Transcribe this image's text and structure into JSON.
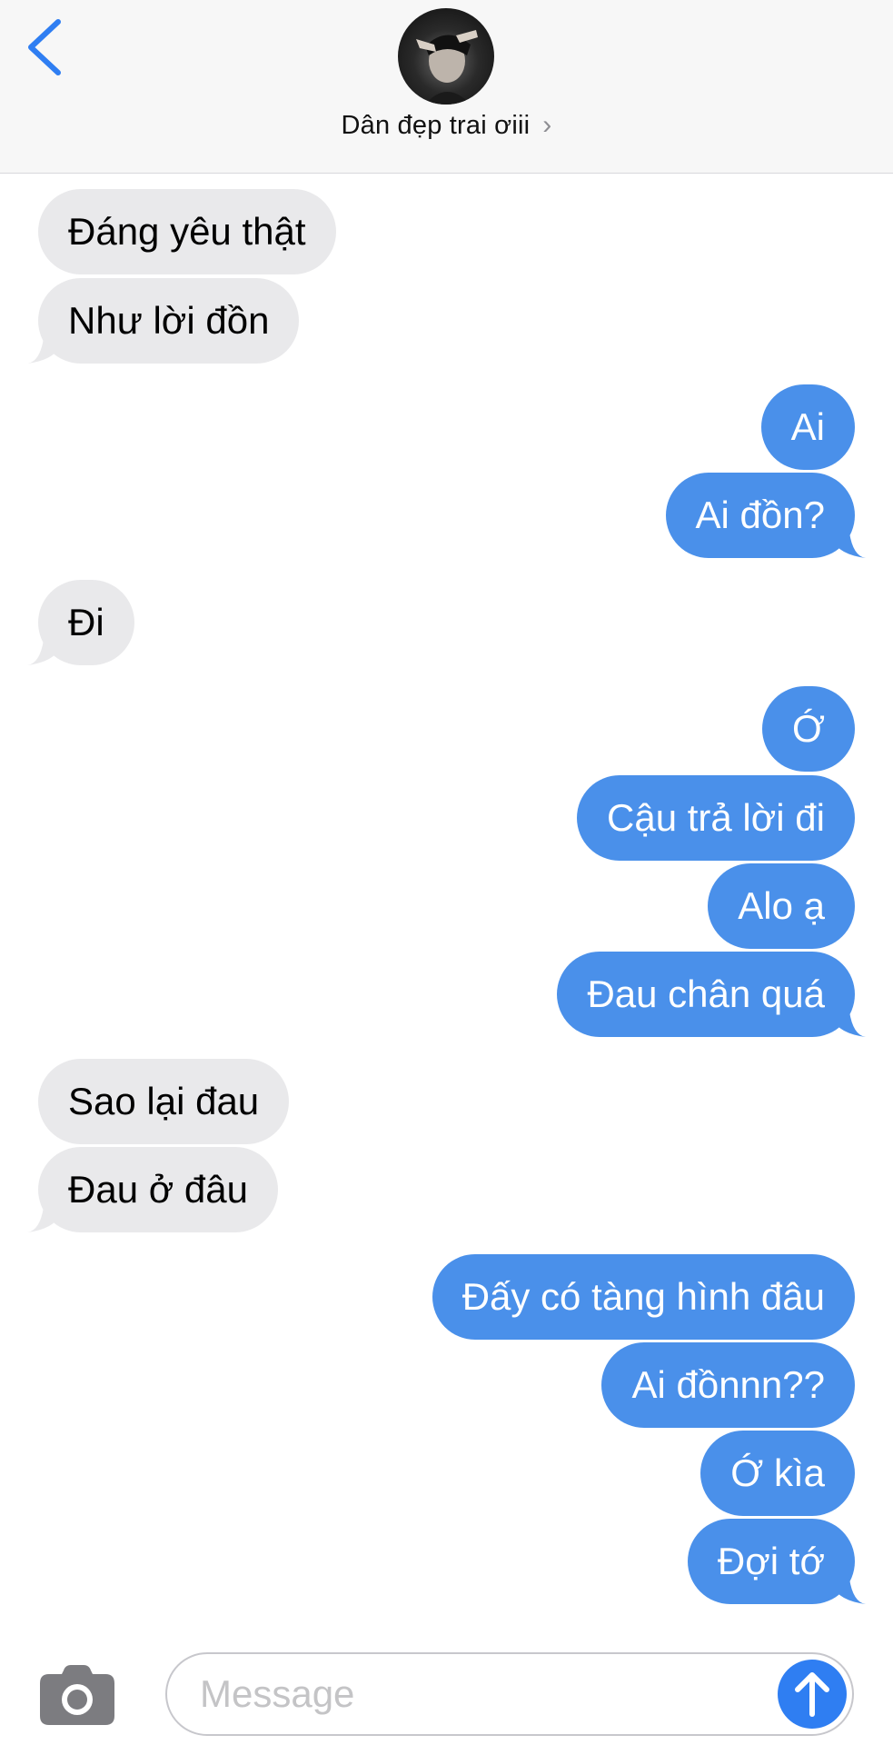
{
  "header": {
    "contact_name": "Dân đẹp trai ơiii",
    "back_icon": "chevron-left-icon",
    "chevron": "›"
  },
  "messages": [
    {
      "from": "them",
      "text": "Đáng yêu thật"
    },
    {
      "from": "them",
      "text": "Như lời đồn"
    },
    {
      "from": "me",
      "text": "Ai"
    },
    {
      "from": "me",
      "text": "Ai đồn?"
    },
    {
      "from": "them",
      "text": "Đi"
    },
    {
      "from": "me",
      "text": "Ớ"
    },
    {
      "from": "me",
      "text": "Cậu trả lời đi"
    },
    {
      "from": "me",
      "text": "Alo ạ"
    },
    {
      "from": "me",
      "text": "Đau chân quá"
    },
    {
      "from": "them",
      "text": "Sao lại đau"
    },
    {
      "from": "them",
      "text": "Đau ở đâu"
    },
    {
      "from": "me",
      "text": "Đấy có tàng hình đâu"
    },
    {
      "from": "me",
      "text": "Ai đồnnn??"
    },
    {
      "from": "me",
      "text": "Ớ kìa"
    },
    {
      "from": "me",
      "text": "Đợi tớ"
    }
  ],
  "composer": {
    "placeholder": "Message",
    "camera_icon": "camera-icon",
    "send_icon": "arrow-up-icon"
  },
  "colors": {
    "sent_bubble": "#4a90ea",
    "received_bubble": "#e9e9eb",
    "accent": "#2f7ef2"
  }
}
